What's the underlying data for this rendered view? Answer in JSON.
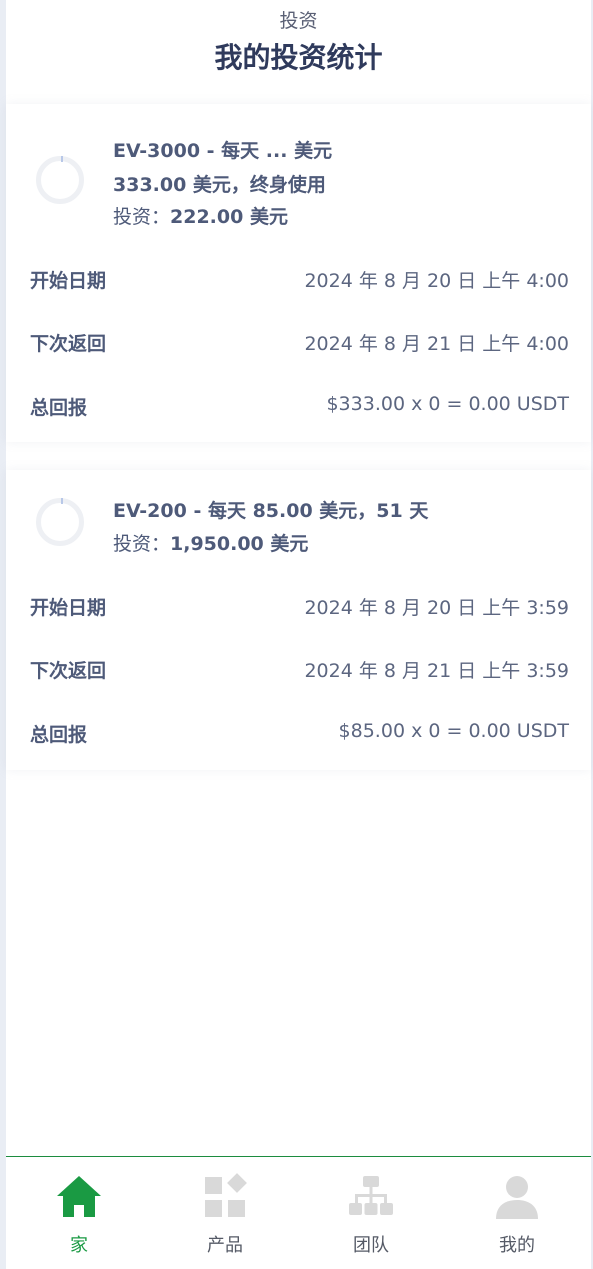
{
  "header": {
    "subtitle": "投资",
    "title": "我的投资统计"
  },
  "investments": [
    {
      "plan_line1": "EV-3000 - 每天 ... 美元",
      "plan_line2": "333.00 美元，终身使用",
      "invest_label": "投资：",
      "invest_amount": "222.00 美元",
      "start_label": "开始日期",
      "start_value": "2024 年 8 月 20 日 上午 4:00",
      "next_label": "下次返回",
      "next_value": "2024 年 8 月 21 日 上午 4:00",
      "total_label": "总回报",
      "total_value": "$333.00 x 0 = 0.00 USDT",
      "progress": 0
    },
    {
      "plan_line1": "EV-200 - 每天 85.00 美元，51 天",
      "invest_label": "投资：",
      "invest_amount": "1,950.00 美元",
      "start_label": "开始日期",
      "start_value": "2024 年 8 月 20 日 上午 3:59",
      "next_label": "下次返回",
      "next_value": "2024 年 8 月 21 日 上午 3:59",
      "total_label": "总回报",
      "total_value": "$85.00 x 0 = 0.00 USDT",
      "progress": 0
    }
  ],
  "tabbar": {
    "active_color": "#1a9a43",
    "inactive_icon_color": "#d9d9d9",
    "items": [
      {
        "label": "家",
        "icon": "home-icon",
        "active": true
      },
      {
        "label": "产品",
        "icon": "products-grid-icon",
        "active": false
      },
      {
        "label": "团队",
        "icon": "team-hierarchy-icon",
        "active": false
      },
      {
        "label": "我的",
        "icon": "user-icon",
        "active": false
      }
    ]
  }
}
